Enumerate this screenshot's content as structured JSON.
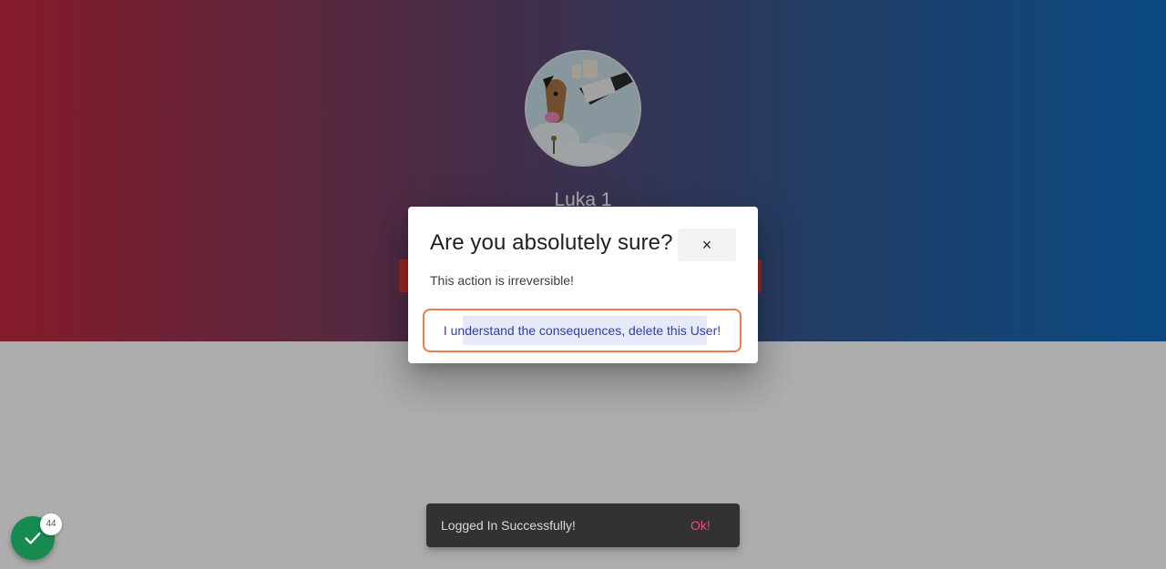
{
  "profile": {
    "name": "Luka 1",
    "avatar_icon": "horse-cartoon-avatar"
  },
  "colors": {
    "hero_gradient_start": "#c4283d",
    "hero_gradient_end": "#0f6cc0",
    "danger": "#e53935",
    "confirm_text": "#3140a8",
    "focus_ring": "#f07c48",
    "snack_action": "#ff4081",
    "fab": "#178a4f"
  },
  "dialog": {
    "title": "Are you absolutely sure?",
    "close_label": "×",
    "message": "This action is irreversible!",
    "confirm_label": "I understand the consequences, delete this User!"
  },
  "snackbar": {
    "message": "Logged In Successfully!",
    "action": "Ok!"
  },
  "fab": {
    "icon": "check-icon",
    "badge_count": "44"
  }
}
